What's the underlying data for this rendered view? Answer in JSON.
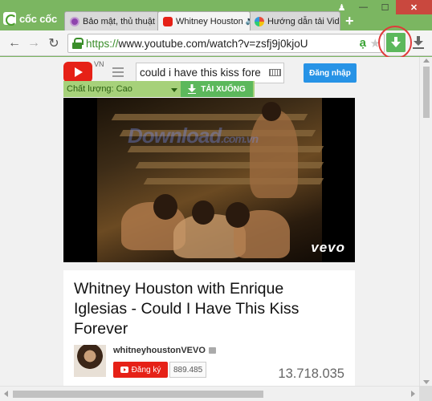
{
  "browser": {
    "logo_text": "cốc cốc",
    "tabs": [
      {
        "label": "Bảo mật, thủ thuật",
        "icon": "shield-tab-favicon"
      },
      {
        "label": "Whitney Houston",
        "icon": "youtube-favicon"
      },
      {
        "label": "Hướng dẫn tải Vid",
        "icon": "download-site-favicon"
      }
    ],
    "new_tab_label": "+",
    "window_controls": {
      "user": "♟",
      "minimize": "—",
      "maximize": "☐",
      "close": "✕"
    },
    "nav": {
      "back": "←",
      "forward": "→",
      "reload": "↻"
    },
    "url_scheme": "https://",
    "url_rest": "www.youtube.com/watch?v=zsfj9j0kjoU",
    "omni_icons": {
      "a": "ạ",
      "star": "★"
    }
  },
  "youtube": {
    "region": "VN",
    "search_value": "could i have this kiss fore",
    "signin_label": "Đăng nhập",
    "downloader": {
      "quality_label": "Chất lượng: Cao",
      "download_label": "TẢI XUỐNG"
    },
    "video": {
      "watermark": "Download",
      "watermark_suffix": ".com.vn",
      "vevo": "vevo"
    },
    "info": {
      "title": "Whitney Houston with Enrique Iglesias - Could I Have This Kiss Forever",
      "channel": "whitneyhoustonVEVO",
      "subscribe_label": "Đăng ký",
      "subscriber_count": "889.485",
      "views": "13.718.035"
    }
  },
  "colors": {
    "browser_chrome": "#7bb661",
    "youtube_red": "#e62117",
    "signin_blue": "#2793e6",
    "download_green": "#5cb85c",
    "highlight_circle": "#e03a3a"
  }
}
